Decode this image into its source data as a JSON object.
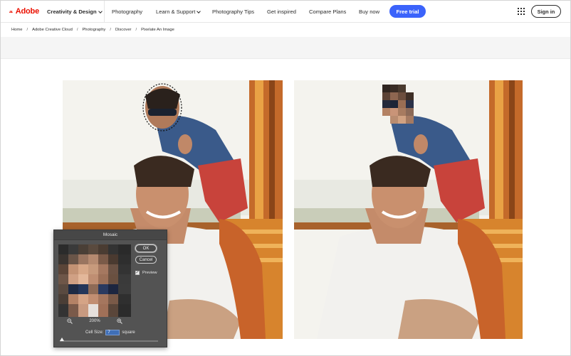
{
  "nav": {
    "logo": "Adobe",
    "items": [
      {
        "label": "Creativity & Design",
        "dropdown": true,
        "active": true
      },
      {
        "label": "Photography",
        "dropdown": false
      },
      {
        "label": "Learn & Support",
        "dropdown": true
      },
      {
        "label": "Photography Tips",
        "dropdown": false
      },
      {
        "label": "Get inspired",
        "dropdown": false
      },
      {
        "label": "Compare Plans",
        "dropdown": false
      },
      {
        "label": "Buy now",
        "dropdown": false
      }
    ],
    "cta": "Free trial",
    "sign_in": "Sign in",
    "accent_color": "#3b63fb",
    "brand_color": "#eb1000"
  },
  "breadcrumb": [
    "Home",
    "Adobe Creative Cloud",
    "Photography",
    "Discover",
    "Pixelate An Image"
  ],
  "breadcrumb_separator": "/",
  "dialog": {
    "title": "Mosaic",
    "ok_label": "OK",
    "cancel_label": "Cancel",
    "preview_label": "Preview",
    "preview_checked": true,
    "zoom_level": "200%",
    "cell_size_label": "Cell Size:",
    "cell_size_value": "7",
    "cell_size_unit": "square"
  }
}
